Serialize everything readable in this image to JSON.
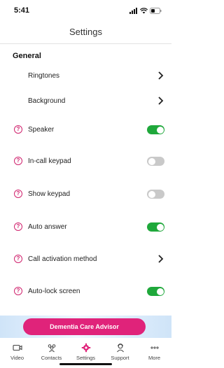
{
  "status_bar": {
    "time": "5:41"
  },
  "nav": {
    "title": "Settings"
  },
  "general": {
    "title": "General",
    "items": [
      {
        "label": "Ringtones",
        "type": "chevron",
        "help": false
      },
      {
        "label": "Background",
        "type": "chevron",
        "help": false
      },
      {
        "label": "Speaker",
        "type": "toggle",
        "on": true,
        "help": true
      },
      {
        "label": "In-call keypad",
        "type": "toggle",
        "on": false,
        "help": true
      },
      {
        "label": "Show keypad",
        "type": "toggle",
        "on": false,
        "help": true
      },
      {
        "label": "Auto answer",
        "type": "toggle",
        "on": true,
        "help": true
      },
      {
        "label": "Call activation method",
        "type": "chevron",
        "help": true
      },
      {
        "label": "Auto-lock screen",
        "type": "toggle",
        "on": true,
        "help": true
      }
    ]
  },
  "help_icon_text": "?",
  "banner": {
    "button_label": "Dementia Care Advisor"
  },
  "tabbar": {
    "tabs": [
      {
        "label": "Video",
        "icon": "video-icon"
      },
      {
        "label": "Contacts",
        "icon": "contacts-icon"
      },
      {
        "label": "Settings",
        "icon": "settings-icon",
        "active": true
      },
      {
        "label": "Support",
        "icon": "support-icon"
      },
      {
        "label": "More",
        "icon": "more-icon"
      }
    ]
  },
  "colors": {
    "accent": "#e0237a",
    "toggle_on": "#1fa83b",
    "toggle_off": "#c9c9c9"
  }
}
